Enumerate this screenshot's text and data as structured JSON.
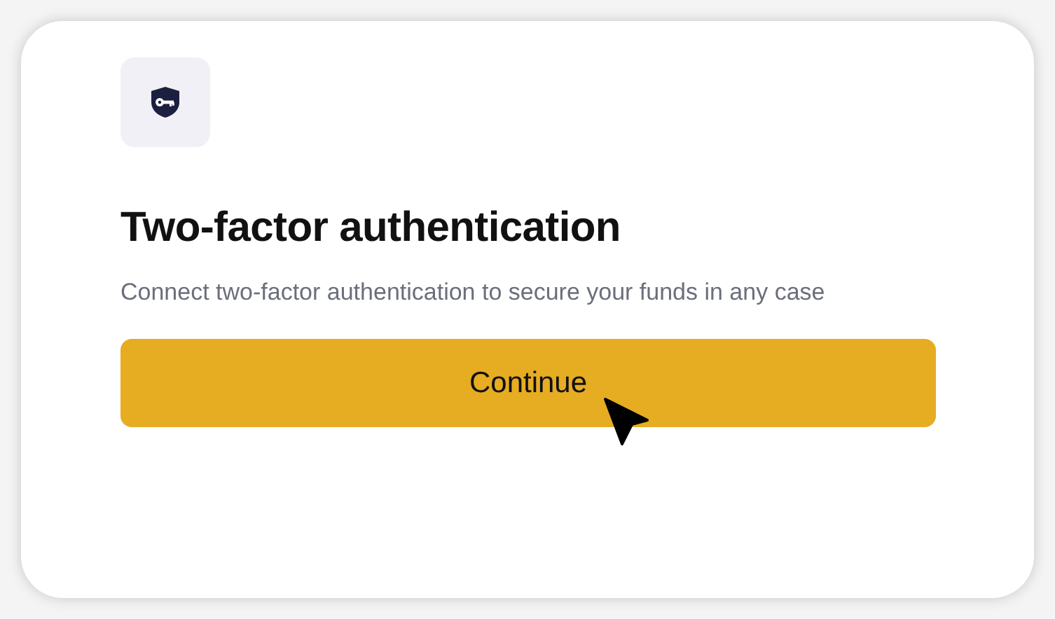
{
  "title": "Two-factor authentication",
  "description": "Connect two-factor authentication to secure your funds in any case",
  "button": {
    "label": "Continue"
  }
}
